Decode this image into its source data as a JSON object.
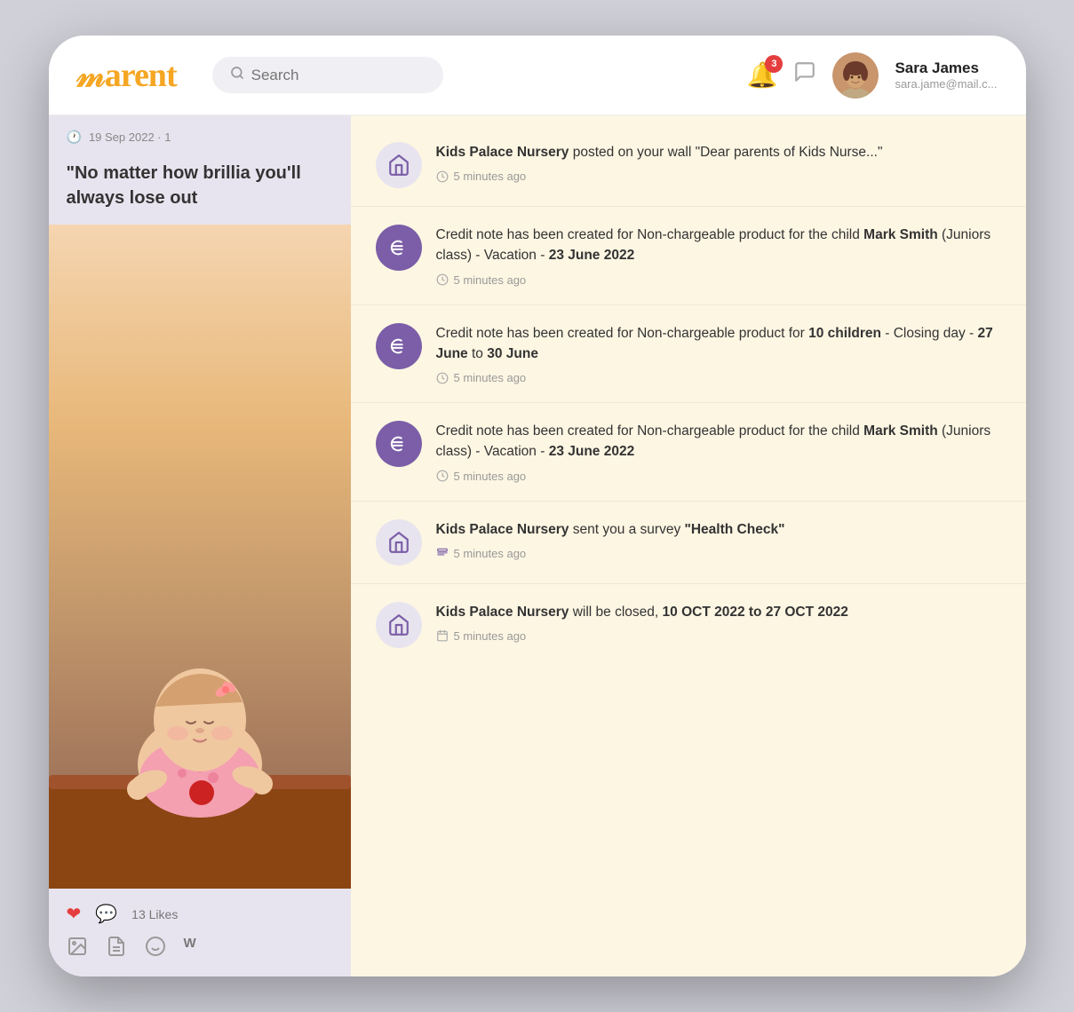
{
  "header": {
    "logo": "Parent",
    "search": {
      "placeholder": "Search"
    },
    "notifications": {
      "count": "3"
    },
    "user": {
      "name": "Sara James",
      "email": "sara.jame@mail.c..."
    }
  },
  "left_panel": {
    "post_date": "19 Sep 2022 · 1",
    "quote": "\"No matter how brillia you'll always lose out",
    "likes_count": "13 Likes"
  },
  "notifications": [
    {
      "icon_type": "school",
      "text_parts": [
        {
          "text": "Kids Palace Nursery",
          "bold": true
        },
        {
          "text": " posted on your wall \"Dear parents of Kids Nurse...\"",
          "bold": false
        }
      ],
      "time": "5 minutes ago"
    },
    {
      "icon_type": "euro",
      "text_parts": [
        {
          "text": "Credit note has been created for Non-chargeable product for the child ",
          "bold": false
        },
        {
          "text": "Mark Smith",
          "bold": true
        },
        {
          "text": " (Juniors class) - Vacation - ",
          "bold": false
        },
        {
          "text": "23 June 2022",
          "bold": true
        }
      ],
      "time": "5 minutes ago"
    },
    {
      "icon_type": "euro",
      "text_parts": [
        {
          "text": "Credit note has been created for Non-chargeable product for ",
          "bold": false
        },
        {
          "text": "10 children",
          "bold": true
        },
        {
          "text": " - Closing day - ",
          "bold": false
        },
        {
          "text": "27 June",
          "bold": true
        },
        {
          "text": " to ",
          "bold": false
        },
        {
          "text": "30 June",
          "bold": true
        }
      ],
      "time": "5 minutes ago"
    },
    {
      "icon_type": "euro",
      "text_parts": [
        {
          "text": "Credit note has been created for Non-chargeable product for the child ",
          "bold": false
        },
        {
          "text": "Mark Smith",
          "bold": true
        },
        {
          "text": " (Juniors class) - Vacation - ",
          "bold": false
        },
        {
          "text": "23 June 2022",
          "bold": true
        }
      ],
      "time": "5 minutes ago"
    },
    {
      "icon_type": "school",
      "text_parts": [
        {
          "text": "Kids Palace Nursery",
          "bold": true
        },
        {
          "text": " sent you a survey ",
          "bold": false
        },
        {
          "text": "\"Health Check\"",
          "bold": true
        }
      ],
      "time": "5 minutes ago",
      "time_icon": "survey"
    },
    {
      "icon_type": "school",
      "text_parts": [
        {
          "text": "Kids Palace Nursery",
          "bold": true
        },
        {
          "text": " will be closed, ",
          "bold": false
        },
        {
          "text": "10 OCT 2022 to 27 OCT 2022",
          "bold": true
        }
      ],
      "time": "5 minutes ago",
      "time_icon": "calendar"
    }
  ]
}
